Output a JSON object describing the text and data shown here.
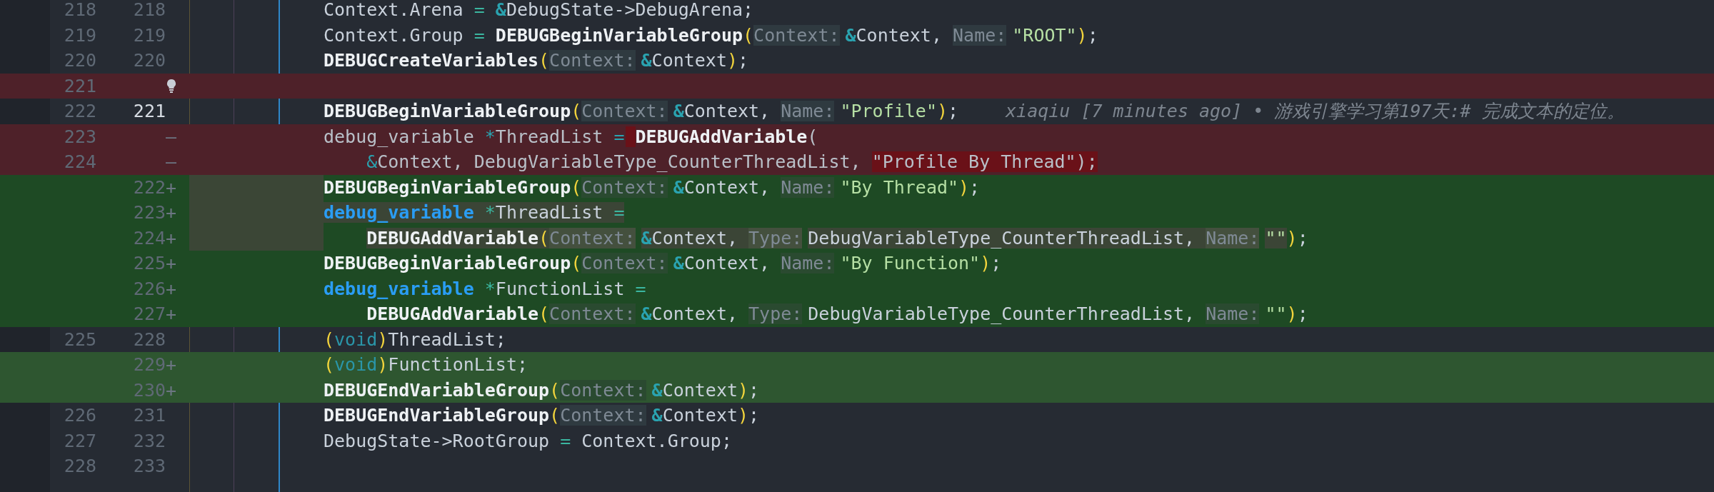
{
  "rows": [
    {
      "kind": "context",
      "old": "218",
      "new": "218",
      "tokens": [
        {
          "kind": "text",
          "text": "Context.Arena "
        },
        {
          "kind": "op",
          "text": "= "
        },
        {
          "kind": "amp",
          "text": "&"
        },
        {
          "kind": "text",
          "text": "DebugState->DebugArena;"
        }
      ]
    },
    {
      "kind": "context",
      "old": "219",
      "new": "219",
      "tokens": [
        {
          "kind": "text",
          "text": "Context.Group "
        },
        {
          "kind": "op",
          "text": "= "
        },
        {
          "kind": "func",
          "text": "DEBUGBeginVariableGroup"
        },
        {
          "kind": "paren",
          "text": "("
        },
        {
          "kind": "hint",
          "text": "Context:"
        },
        {
          "kind": "amp",
          "text": "&"
        },
        {
          "kind": "text",
          "text": "Context, "
        },
        {
          "kind": "hint",
          "text": "Name:"
        },
        {
          "kind": "str",
          "text": "\"ROOT\""
        },
        {
          "kind": "paren",
          "text": ")"
        },
        {
          "kind": "text",
          "text": ";"
        }
      ]
    },
    {
      "kind": "context",
      "old": "220",
      "new": "220",
      "tokens": [
        {
          "kind": "func",
          "text": "DEBUGCreateVariables"
        },
        {
          "kind": "paren",
          "text": "("
        },
        {
          "kind": "hint",
          "text": "Context:"
        },
        {
          "kind": "amp",
          "text": "&"
        },
        {
          "kind": "text",
          "text": "Context"
        },
        {
          "kind": "paren",
          "text": ")"
        },
        {
          "kind": "text",
          "text": ";"
        }
      ]
    },
    {
      "kind": "removed",
      "old": "221",
      "lightbulb": true,
      "tokens": []
    },
    {
      "kind": "context",
      "old": "222",
      "new": "221",
      "current": true,
      "tokens": [
        {
          "kind": "func",
          "text": "DEBUGBeginVariableGroup"
        },
        {
          "kind": "paren",
          "text": "("
        },
        {
          "kind": "hint",
          "text": "Context:"
        },
        {
          "kind": "amp",
          "text": "&"
        },
        {
          "kind": "text",
          "text": "Context, "
        },
        {
          "kind": "hint",
          "text": "Name:"
        },
        {
          "kind": "str",
          "text": "\"Profile\""
        },
        {
          "kind": "paren",
          "text": ")"
        },
        {
          "kind": "text",
          "text": ";"
        }
      ],
      "blame": "xiaqiu [7 minutes ago] • 游戏引擎学习第197天:# 完成文本的定位。"
    },
    {
      "kind": "removed",
      "old": "223",
      "marker": "—",
      "tokens": [
        {
          "kind": "text",
          "text": "debug_variable "
        },
        {
          "kind": "op",
          "text": "*"
        },
        {
          "kind": "text",
          "text": "ThreadList "
        },
        {
          "kind": "op",
          "text": "= "
        },
        {
          "kind": "func",
          "text": "DEBUGAddVariable",
          "changed": true
        },
        {
          "kind": "text",
          "text": "("
        }
      ]
    },
    {
      "kind": "removed",
      "old": "224",
      "marker": "—",
      "continuation": true,
      "tokens": [
        {
          "kind": "amp",
          "text": "&"
        },
        {
          "kind": "text",
          "text": "Context, DebugVariableType_CounterThreadList, "
        },
        {
          "kind": "str",
          "text": "\"Profile By Thread\"",
          "changed": true
        },
        {
          "kind": "text",
          "text": ");",
          "changed": true
        }
      ]
    },
    {
      "kind": "added",
      "new": "222",
      "marker": "+",
      "indent_highlight": true,
      "tokens": [
        {
          "kind": "func",
          "text": "DEBUGBeginVariableGroup"
        },
        {
          "kind": "paren",
          "text": "("
        },
        {
          "kind": "hint",
          "text": "Context:"
        },
        {
          "kind": "amp",
          "text": "&"
        },
        {
          "kind": "text",
          "text": "Context, "
        },
        {
          "kind": "hint",
          "text": "Name:"
        },
        {
          "kind": "str",
          "text": "\"By Thread\""
        },
        {
          "kind": "paren",
          "text": ")"
        },
        {
          "kind": "text",
          "text": ";"
        }
      ]
    },
    {
      "kind": "added",
      "new": "223",
      "marker": "+",
      "indent_highlight": true,
      "tokens": [
        {
          "kind": "kw",
          "text": "debug_variable ",
          "selected": true
        },
        {
          "kind": "op",
          "text": "*",
          "selected": true
        },
        {
          "kind": "text",
          "text": "ThreadList ",
          "selected": true
        },
        {
          "kind": "op",
          "text": "=",
          "selected": true
        }
      ]
    },
    {
      "kind": "added",
      "new": "224",
      "marker": "+",
      "indent_highlight": true,
      "continuation": true,
      "tokens": [
        {
          "kind": "func",
          "text": "DEBUGAddVariable",
          "selected": true
        },
        {
          "kind": "paren",
          "text": "(",
          "selected": true
        },
        {
          "kind": "hint",
          "text": "Context:",
          "selected": true
        },
        {
          "kind": "amp",
          "text": "&",
          "selected": true
        },
        {
          "kind": "text",
          "text": "Context, ",
          "selected": true
        },
        {
          "kind": "hint",
          "text": "Type:",
          "selected": true
        },
        {
          "kind": "text",
          "text": "DebugVariableType_CounterThreadList, ",
          "selected": true
        },
        {
          "kind": "hint",
          "text": "Name:",
          "selected": true
        },
        {
          "kind": "str",
          "text": "\"\"",
          "selected": true
        },
        {
          "kind": "paren",
          "text": ")"
        },
        {
          "kind": "text",
          "text": ";"
        }
      ]
    },
    {
      "kind": "added",
      "new": "225",
      "marker": "+",
      "tokens": [
        {
          "kind": "func",
          "text": "DEBUGBeginVariableGroup"
        },
        {
          "kind": "paren",
          "text": "("
        },
        {
          "kind": "hint",
          "text": "Context:"
        },
        {
          "kind": "amp",
          "text": "&"
        },
        {
          "kind": "text",
          "text": "Context, "
        },
        {
          "kind": "hint",
          "text": "Name:"
        },
        {
          "kind": "str",
          "text": "\"By Function\""
        },
        {
          "kind": "paren",
          "text": ")"
        },
        {
          "kind": "text",
          "text": ";"
        }
      ]
    },
    {
      "kind": "added",
      "new": "226",
      "marker": "+",
      "tokens": [
        {
          "kind": "kw",
          "text": "debug_variable "
        },
        {
          "kind": "op",
          "text": "*"
        },
        {
          "kind": "text",
          "text": "FunctionList "
        },
        {
          "kind": "op",
          "text": "="
        }
      ]
    },
    {
      "kind": "added",
      "new": "227",
      "marker": "+",
      "continuation": true,
      "tokens": [
        {
          "kind": "func",
          "text": "DEBUGAddVariable"
        },
        {
          "kind": "paren",
          "text": "("
        },
        {
          "kind": "hint",
          "text": "Context:"
        },
        {
          "kind": "amp",
          "text": "&"
        },
        {
          "kind": "text",
          "text": "Context, "
        },
        {
          "kind": "hint",
          "text": "Type:"
        },
        {
          "kind": "text",
          "text": "DebugVariableType_CounterThreadList, "
        },
        {
          "kind": "hint",
          "text": "Name:"
        },
        {
          "kind": "str",
          "text": "\"\""
        },
        {
          "kind": "paren",
          "text": ")"
        },
        {
          "kind": "text",
          "text": ";"
        }
      ]
    },
    {
      "kind": "context",
      "old": "225",
      "new": "228",
      "tokens": [
        {
          "kind": "paren",
          "text": "("
        },
        {
          "kind": "type",
          "text": "void"
        },
        {
          "kind": "paren",
          "text": ")"
        },
        {
          "kind": "text",
          "text": "ThreadList;"
        }
      ]
    },
    {
      "kind": "added",
      "new": "229",
      "marker": "+",
      "highlighted": true,
      "tokens": [
        {
          "kind": "paren",
          "text": "("
        },
        {
          "kind": "type",
          "text": "void"
        },
        {
          "kind": "paren",
          "text": ")"
        },
        {
          "kind": "text",
          "text": "FunctionList;"
        }
      ]
    },
    {
      "kind": "added",
      "new": "230",
      "marker": "+",
      "highlighted": true,
      "tokens": [
        {
          "kind": "func",
          "text": "DEBUGEndVariableGroup"
        },
        {
          "kind": "paren",
          "text": "("
        },
        {
          "kind": "hint",
          "text": "Context:"
        },
        {
          "kind": "amp",
          "text": "&"
        },
        {
          "kind": "text",
          "text": "Context"
        },
        {
          "kind": "paren",
          "text": ")"
        },
        {
          "kind": "text",
          "text": ";"
        }
      ]
    },
    {
      "kind": "context",
      "old": "226",
      "new": "231",
      "tokens": [
        {
          "kind": "func",
          "text": "DEBUGEndVariableGroup"
        },
        {
          "kind": "paren",
          "text": "("
        },
        {
          "kind": "hint",
          "text": "Context:"
        },
        {
          "kind": "amp",
          "text": "&"
        },
        {
          "kind": "text",
          "text": "Context"
        },
        {
          "kind": "paren",
          "text": ")"
        },
        {
          "kind": "text",
          "text": ";"
        }
      ]
    },
    {
      "kind": "context",
      "old": "227",
      "new": "232",
      "tokens": [
        {
          "kind": "text",
          "text": "DebugState->RootGroup "
        },
        {
          "kind": "op",
          "text": "="
        },
        {
          "kind": "text",
          "text": " Context.Group;"
        }
      ]
    },
    {
      "kind": "context",
      "old": "228",
      "new": "233",
      "tokens": []
    },
    {
      "kind": "context",
      "tokens": []
    }
  ]
}
